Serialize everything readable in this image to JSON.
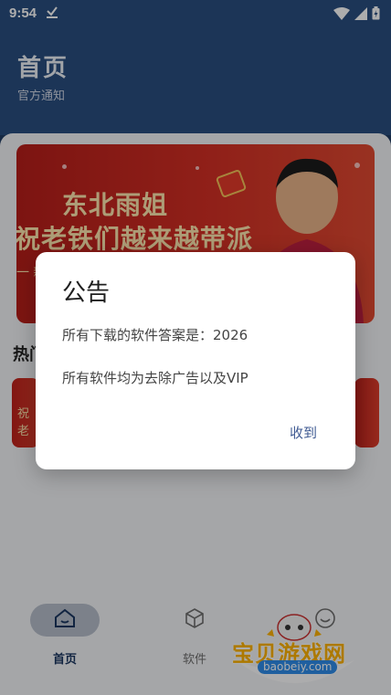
{
  "status_bar": {
    "time": "9:54"
  },
  "header": {
    "title": "首页",
    "subtitle": "官方通知"
  },
  "banner": {
    "line1": "东北雨姐",
    "line2": "祝老铁们越来越带派",
    "fragment": "一 新"
  },
  "section": {
    "hot_title": "热门"
  },
  "hot_cards": [
    {
      "text": "祝老"
    }
  ],
  "nav": {
    "items": [
      {
        "label": "首页",
        "icon": "home-icon",
        "active": true
      },
      {
        "label": "软件",
        "icon": "box-icon",
        "active": false
      },
      {
        "label": "",
        "icon": "smile-icon",
        "active": false
      }
    ]
  },
  "watermark": {
    "name": "宝贝游戏网",
    "url": "baobeiy.com"
  },
  "dialog": {
    "title": "公告",
    "line1": "所有下载的软件答案是：2026",
    "line2": "所有软件均为去除广告以及VIP",
    "confirm_label": "收到"
  },
  "colors": {
    "header": "#2a4e80",
    "banner_red": "#d53025",
    "dialog_button": "#3f5a92",
    "nav_active": "#1a3660"
  }
}
